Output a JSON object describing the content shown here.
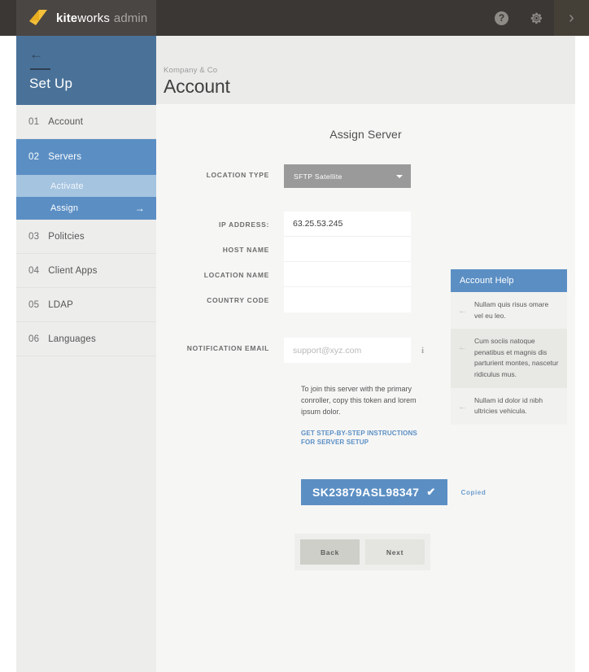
{
  "topbar": {
    "brand_bold": "kite",
    "brand_rest": "works",
    "brand_suffix": "admin",
    "logo_icon": "kite-logo-icon",
    "help_icon": "question-mark-icon",
    "help_glyph": "?",
    "settings_icon": "gear-icon",
    "expand_icon": "chevron-right-icon",
    "expand_glyph": "›"
  },
  "sidebar": {
    "back_glyph": "←",
    "title": "Set Up",
    "items": [
      {
        "num": "01",
        "label": "Account"
      },
      {
        "num": "02",
        "label": "Servers"
      },
      {
        "num": "03",
        "label": "Politcies"
      },
      {
        "num": "04",
        "label": "Client Apps"
      },
      {
        "num": "05",
        "label": "LDAP"
      },
      {
        "num": "06",
        "label": "Languages"
      }
    ],
    "sub_items": [
      {
        "label": "Activate"
      },
      {
        "label": "Assign",
        "arrow": "→"
      }
    ]
  },
  "header": {
    "breadcrumb": "Kompany & Co",
    "title": "Account"
  },
  "form": {
    "title": "Assign Server",
    "location_type_label": "LOCATION TYPE",
    "location_type_value": "SFTP Satellite",
    "fields": [
      {
        "label": "IP ADDRESS:",
        "value": "63.25.53.245"
      },
      {
        "label": "HOST NAME",
        "value": ""
      },
      {
        "label": "LOCATION NAME",
        "value": ""
      },
      {
        "label": "COUNTRY CODE",
        "value": ""
      }
    ],
    "email_label": "NOTIFICATION EMAIL",
    "email_placeholder": "support@xyz.com",
    "email_value": "",
    "info_glyph": "i",
    "help_text": "To join this server with the primary conroller, copy this token and lorem ipsum dolor.",
    "help_link": "Get step-by-step instructions for server setup",
    "token": "SK23879ASL98347",
    "token_check": "✔",
    "copied_label": "Copied",
    "back_label": "Back",
    "next_label": "Next"
  },
  "help_panel": {
    "title": "Account Help",
    "arrow_glyph": "←",
    "items": [
      {
        "text": "Nullam quis risus omare vel eu leo."
      },
      {
        "text": "Cum sociis natoque penatibus et magnis dis parturient montes, nascetur ridiculus mus."
      },
      {
        "text": "Nullam id dolor id nibh ultricies vehicula."
      }
    ]
  },
  "colors": {
    "accent_blue": "#5b8fc4",
    "sidebar_blue": "#4a7299",
    "light_blue": "#a5c4e0",
    "topbar_dark": "#3a3734",
    "logo_yellow": "#f5c03a"
  }
}
